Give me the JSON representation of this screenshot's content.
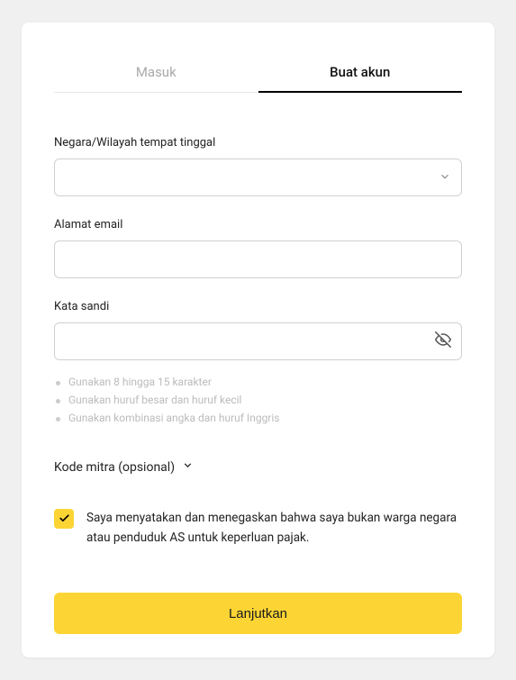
{
  "tabs": {
    "login": "Masuk",
    "signup": "Buat akun"
  },
  "fields": {
    "country_label": "Negara/Wilayah tempat tinggal",
    "email_label": "Alamat email",
    "password_label": "Kata sandi"
  },
  "password_hints": [
    "Gunakan 8 hingga 15 karakter",
    "Gunakan huruf besar dan huruf kecil",
    "Gunakan kombinasi angka dan huruf Inggris"
  ],
  "partner_code_label": "Kode mitra (opsional)",
  "consent_text": "Saya menyatakan dan menegaskan bahwa saya bukan warga negara atau penduduk AS untuk keperluan pajak.",
  "submit_label": "Lanjutkan",
  "colors": {
    "accent": "#fcd535"
  }
}
